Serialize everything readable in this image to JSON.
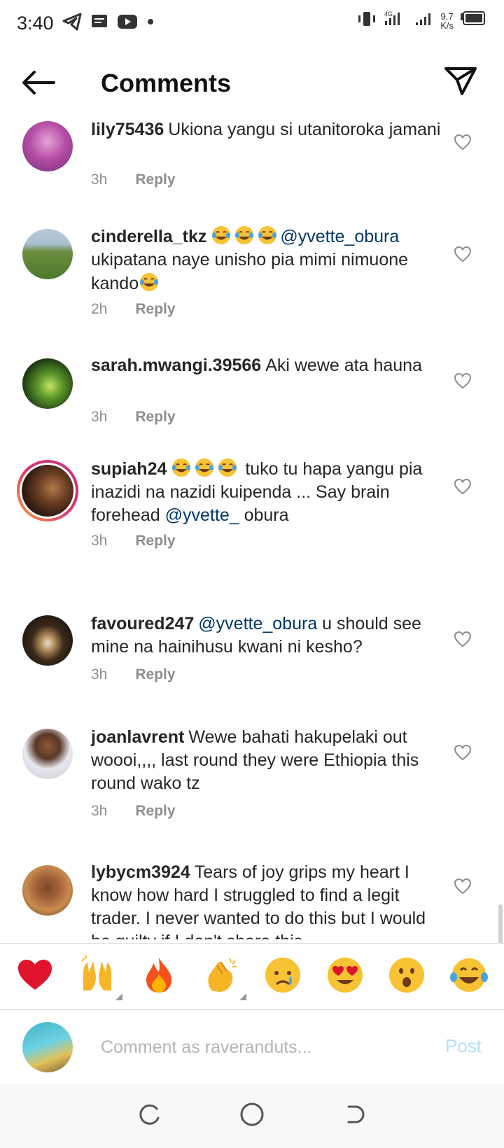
{
  "status_bar": {
    "time": "3:40",
    "net_speed_value": "9.7",
    "net_speed_unit": "K/s",
    "network_label": "4G",
    "icons": [
      "telegram-icon",
      "message-icon",
      "youtube-icon",
      "dot-icon",
      "vibrate-icon",
      "signal-icon",
      "signal-icon",
      "battery-icon"
    ]
  },
  "header": {
    "title": "Comments",
    "back_icon": "arrow-left-icon",
    "send_icon": "paper-plane-icon"
  },
  "comments": [
    {
      "username": "lily75436",
      "emojis": 0,
      "parts": [
        {
          "t": "Ukiona yangu si utanitoroka jamani",
          "m": false
        }
      ],
      "time": "3h",
      "reply": "Reply"
    },
    {
      "username": "cinderella_tkz",
      "emojis": 3,
      "parts": [
        {
          "t": "@yvette_obura",
          "m": true
        },
        {
          "t": " ukipatana naye unisho pia mimi nimuone kando",
          "m": false
        }
      ],
      "trailing_emoji": true,
      "time": "2h",
      "reply": "Reply"
    },
    {
      "username": "sarah.mwangi.39566",
      "emojis": 0,
      "parts": [
        {
          "t": "Aki wewe ata hauna",
          "m": false
        }
      ],
      "time": "3h",
      "reply": "Reply"
    },
    {
      "username": "supiah24",
      "emojis": 3,
      "parts": [
        {
          "t": "tuko tu hapa yangu pia inazidi na nazidi kuipenda ... Say brain forehead ",
          "m": false
        },
        {
          "t": "@yvette_",
          "m": true
        },
        {
          "t": " obura",
          "m": false
        }
      ],
      "time": "3h",
      "reply": "Reply"
    },
    {
      "username": "favoured247",
      "emojis": 0,
      "parts": [
        {
          "t": "@yvette_obura",
          "m": true
        },
        {
          "t": " u should see mine na hainihusu kwani ni kesho?",
          "m": false
        }
      ],
      "time": "3h",
      "reply": "Reply"
    },
    {
      "username": "joanlavrent",
      "emojis": 0,
      "parts": [
        {
          "t": "Wewe bahati hakupelaki out woooi,,,, last round they were Ethiopia this round wako tz",
          "m": false
        }
      ],
      "time": "3h",
      "reply": "Reply"
    },
    {
      "username": "lybycm3924",
      "emojis": 0,
      "parts": [
        {
          "t": "Tears of joy grips my heart I know how hard I struggled to find a legit trader. I never wanted to do this but I would be guilty if I don't share this",
          "m": false
        }
      ],
      "time": "",
      "reply": ""
    }
  ],
  "emoji_bar": [
    {
      "name": "red-heart-emoji",
      "char": "❤️",
      "more": false
    },
    {
      "name": "raising-hands-emoji",
      "char": "🙌",
      "more": true
    },
    {
      "name": "fire-emoji",
      "char": "🔥",
      "more": false
    },
    {
      "name": "clapping-hands-emoji",
      "char": "👏",
      "more": true
    },
    {
      "name": "crying-face-emoji",
      "char": "😢",
      "more": false
    },
    {
      "name": "heart-eyes-emoji",
      "char": "😍",
      "more": false
    },
    {
      "name": "surprised-face-emoji",
      "char": "😮",
      "more": false
    },
    {
      "name": "tears-of-joy-emoji",
      "char": "😂",
      "more": false
    }
  ],
  "composer": {
    "placeholder": "Comment as raveranduts...",
    "post_label": "Post"
  },
  "colors": {
    "mention": "#00376b",
    "meta_gray": "#8e8e8e",
    "post_disabled": "#b2dffc",
    "story_ring_start": "#f9a23a",
    "story_ring_end": "#c13584"
  }
}
